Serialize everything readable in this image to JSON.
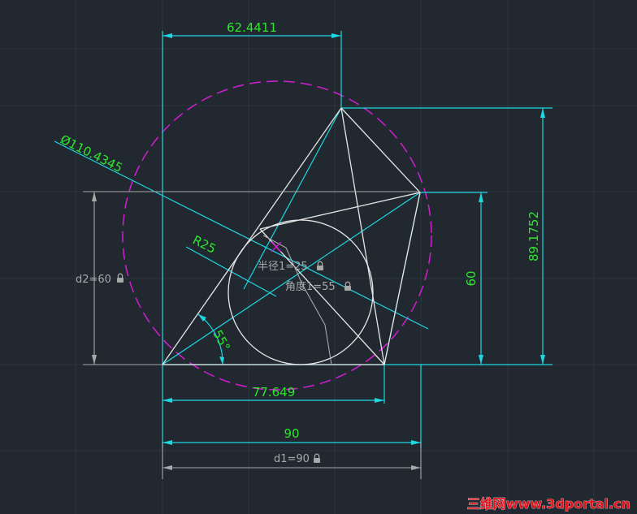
{
  "colors": {
    "background": "#212830",
    "grid": "#2c343e",
    "geometry": "#e6e6e6",
    "dimension": "#1ed7e1",
    "dimension_text": "#2ee62e",
    "constraint": "#a8a8a8",
    "circle_dashed": "#d21ed2",
    "watermark": "#e1141e"
  },
  "dimensions": {
    "top_width": "62.4411",
    "diameter": "Ø110.4345",
    "radius": "R25",
    "angle": "55°",
    "bottom_inner": "77.649",
    "bottom_width": "90",
    "right_height": "60",
    "right_total_height": "89.1752"
  },
  "constraints": {
    "d2": "d2=60",
    "d1": "d1=90",
    "radius1": "半径1=25",
    "angle1": "角度1=55"
  },
  "icons": {
    "lock": "lock-icon"
  },
  "watermark": "三维网www.3dportal.cn"
}
